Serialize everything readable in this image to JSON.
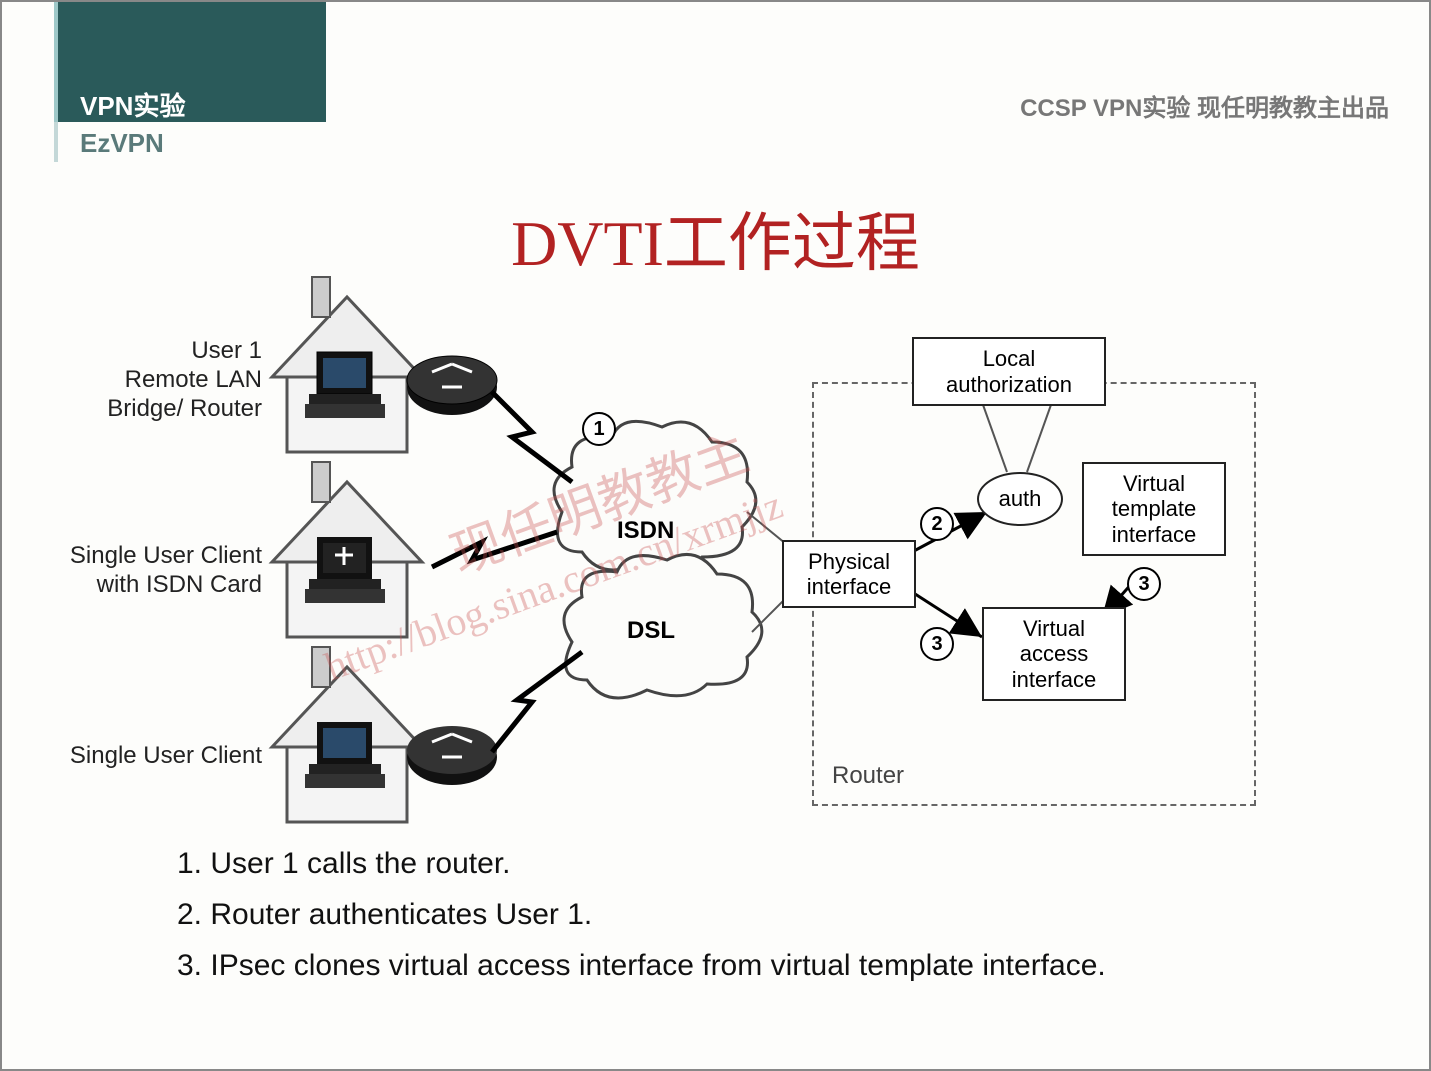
{
  "header": {
    "title": "VPN实验",
    "subtitle": "EzVPN",
    "right": "CCSP VPN实验  现任明教教主出品"
  },
  "main_title": "DVTI工作过程",
  "clients": [
    {
      "label": "User 1\nRemote LAN\nBridge/ Router"
    },
    {
      "label": "Single User Client\nwith ISDN Card"
    },
    {
      "label": "Single User Client"
    }
  ],
  "clouds": {
    "isdn": "ISDN",
    "dsl": "DSL"
  },
  "router": {
    "label": "Router",
    "physical": "Physical\ninterface",
    "auth": "auth",
    "local_auth": "Local\nauthorization",
    "vtemplate": "Virtual\ntemplate\ninterface",
    "vaccess": "Virtual\naccess\ninterface"
  },
  "step_markers": {
    "s1": "1",
    "s2": "2",
    "s3a": "3",
    "s3b": "3"
  },
  "steps": [
    "1. User 1 calls the router.",
    "2. Router  authenticates User 1.",
    "3. IPsec clones virtual access interface from virtual template interface."
  ],
  "watermark": {
    "text1": "现任明教教主",
    "text2": "http://blog.sina.com.cn/xrmjjz"
  }
}
